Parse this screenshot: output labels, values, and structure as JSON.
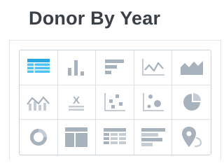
{
  "header": {
    "title": "Donor By Year"
  },
  "chart_picker": {
    "options": [
      {
        "icon": "table-icon",
        "selected": true
      },
      {
        "icon": "bar-chart-icon"
      },
      {
        "icon": "row-chart-icon"
      },
      {
        "icon": "line-chart-icon"
      },
      {
        "icon": "area-chart-icon"
      },
      {
        "icon": "combo-chart-icon"
      },
      {
        "icon": "trend-number-icon",
        "glyph": "X"
      },
      {
        "icon": "scatter-plot-icon"
      },
      {
        "icon": "bubble-chart-icon"
      },
      {
        "icon": "pie-chart-icon"
      },
      {
        "icon": "donut-chart-icon"
      },
      {
        "icon": "detail-layout-icon"
      },
      {
        "icon": "pivot-table-icon"
      },
      {
        "icon": "funnel-bars-icon"
      },
      {
        "icon": "map-pin-icon"
      }
    ],
    "colors": {
      "icon": "#a8b2bc",
      "icon_light": "#c5ccd3",
      "selected": "#4fc3f7",
      "grid_border": "#c9d1d9",
      "cell_divider": "#dde2e7"
    }
  }
}
